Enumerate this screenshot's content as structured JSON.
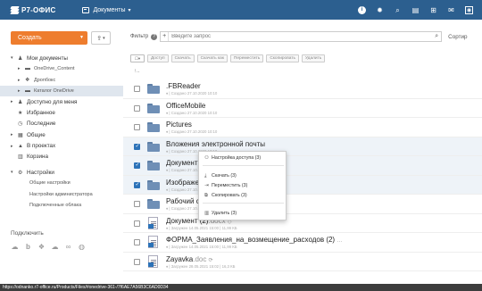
{
  "header": {
    "logo": "Р7-ОФИС",
    "module": "Документы",
    "icons": [
      "info-icon",
      "settings-icon",
      "search-icon",
      "chat-icon",
      "grid-icon",
      "mail-icon",
      "avatar"
    ]
  },
  "sidebar": {
    "create_label": "Создать",
    "items": [
      {
        "label": "Мои документы",
        "icon": "user-icon",
        "level": 0
      },
      {
        "label": "OneDrive_Content",
        "icon": "folder-icon",
        "level": 1
      },
      {
        "label": "Дропбокс",
        "icon": "dropbox-icon",
        "level": 1
      },
      {
        "label": "Каталог OneDrive",
        "icon": "folder-icon",
        "level": 1
      },
      {
        "label": "Доступно для меня",
        "icon": "users-icon",
        "level": 0
      },
      {
        "label": "Избранное",
        "icon": "star-icon",
        "level": 0
      },
      {
        "label": "Последние",
        "icon": "clock-icon",
        "level": 0
      },
      {
        "label": "Общие",
        "icon": "share-icon",
        "level": 0
      },
      {
        "label": "В проектах",
        "icon": "projects-icon",
        "level": 0
      },
      {
        "label": "Корзина",
        "icon": "trash-icon",
        "level": 0
      },
      {
        "label": "Настройки",
        "icon": "gear-icon",
        "level": 0
      },
      {
        "label": "Общие настройки",
        "level": 2
      },
      {
        "label": "Настройки администратора",
        "level": 2
      },
      {
        "label": "Подключенные облака",
        "level": 2
      }
    ],
    "connect_label": "Подключить"
  },
  "main": {
    "filter_label": "Фильтр",
    "search_placeholder": "Введите запрос",
    "sort_label": "Сортир",
    "actions": [
      "Доступ",
      "Скачать",
      "Скачать как",
      "Переместить",
      "Скопировать",
      "Удалить"
    ],
    "up_label": "↑..",
    "rows": [
      {
        "name": ".FBReader",
        "ext": "",
        "meta": "♦ | Создано 27.10.2020 10:10",
        "checked": false,
        "kind": "folder"
      },
      {
        "name": "OfficeMobile",
        "ext": "",
        "meta": "♦ | Создано 27.10.2020 10:10",
        "checked": false,
        "kind": "folder"
      },
      {
        "name": "Pictures",
        "ext": "",
        "meta": "♦ | Создано 27.10.2020 10:10",
        "checked": false,
        "kind": "folder"
      },
      {
        "name": "Вложения электронной почты",
        "ext": "",
        "meta": "♦ | Создано 27.10.2020 10:10",
        "checked": true,
        "kind": "folder"
      },
      {
        "name": "Документ",
        "ext": "",
        "meta": "♦ | Создано 27.10.2020 10:10",
        "checked": true,
        "kind": "folder"
      },
      {
        "name": "Изображе",
        "ext": "",
        "meta": "♦ | Создано 27.10.2020 10:10",
        "checked": true,
        "kind": "folder"
      },
      {
        "name": "Рабочий с",
        "ext": "",
        "meta": "♦ | Создано 27.10.2020 10:10",
        "checked": false,
        "kind": "folder"
      },
      {
        "name": "Документ (2)",
        "ext": ".docx",
        "meta": "♦ | Загружен 14.05.2021 15:00 | 11,99 КБ",
        "checked": false,
        "kind": "doc"
      },
      {
        "name": "ФОРМА_Заявления_на_возмещение_расходов (2)",
        "ext": "",
        "meta": "♦ | Загружен 14.05.2021 15:00 | 11,99 КБ",
        "checked": false,
        "kind": "doc"
      },
      {
        "name": "Zayavka",
        "ext": ".doc",
        "meta": "♦ | Загружен 28.05.2021 15:02 | 16,3 КБ",
        "checked": false,
        "kind": "doc"
      }
    ]
  },
  "context_menu": [
    {
      "label": "Настройка доступа (3)",
      "icon": "access-icon"
    },
    {
      "label": "Скачать (3)",
      "icon": "download-icon"
    },
    {
      "label": "Переместить (3)",
      "icon": "move-icon"
    },
    {
      "label": "Скопировать (3)",
      "icon": "copy-icon"
    },
    {
      "label": "Удалить (3)",
      "icon": "trash-icon"
    }
  ],
  "status_url": "https://odnanko.r7-office.ru/Products/Files/#onedrive-361-/7f6AE7A56B3C6AD0D34",
  "colors": {
    "header": "#2c5f8f",
    "create": "#ee7d2e",
    "checked": "#2c72b8"
  }
}
